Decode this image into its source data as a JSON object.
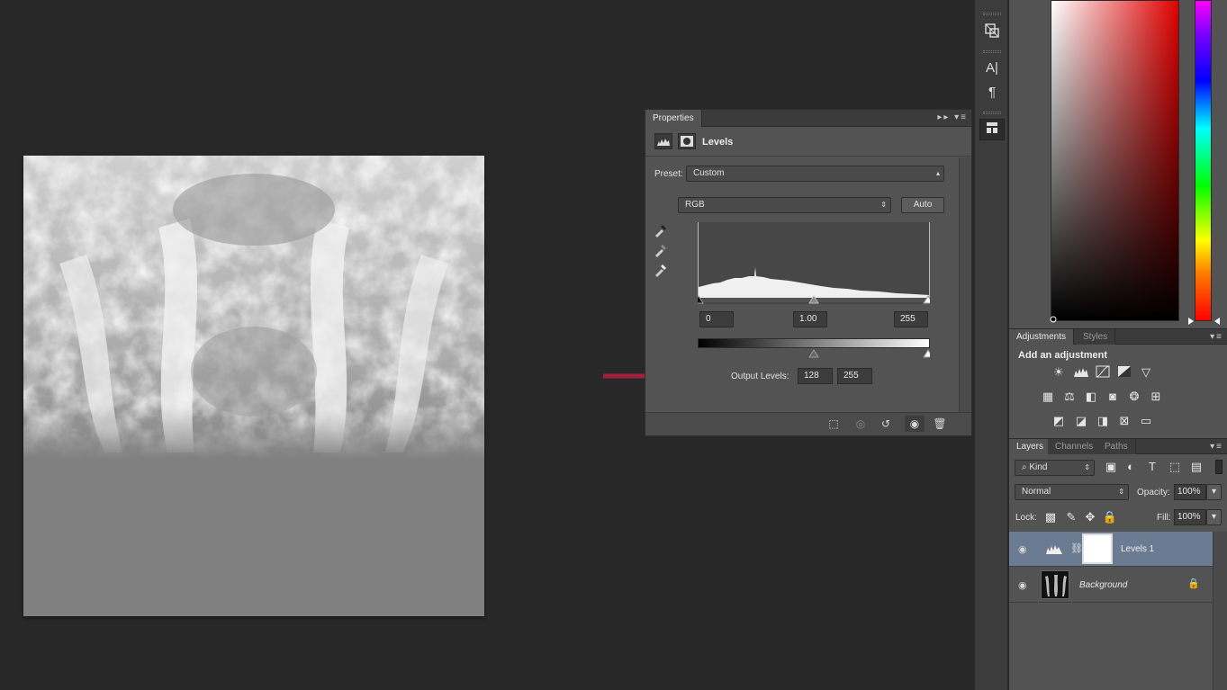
{
  "properties": {
    "tab_label": "Properties",
    "title": "Levels",
    "preset_label": "Preset:",
    "preset_value": "Custom",
    "channel_value": "RGB",
    "auto_label": "Auto",
    "input_black": "0",
    "input_gamma": "1.00",
    "input_white": "255",
    "output_label": "Output Levels:",
    "output_black": "128",
    "output_white": "255"
  },
  "tools": {
    "type_label": "A|",
    "paragraph_label": "¶"
  },
  "adjustments": {
    "tabs": [
      "Adjustments",
      "Styles"
    ],
    "heading": "Add an adjustment"
  },
  "layers": {
    "tabs": [
      "Layers",
      "Channels",
      "Paths"
    ],
    "filter_value": "Kind",
    "blend_mode": "Normal",
    "opacity_label": "Opacity:",
    "opacity_value": "100%",
    "lock_label": "Lock:",
    "fill_label": "Fill:",
    "fill_value": "100%",
    "items": [
      {
        "name": "Levels 1"
      },
      {
        "name": "Background"
      }
    ]
  },
  "colors": {
    "arrow": "#a3213f",
    "layer_selected": "#6b7b92"
  }
}
